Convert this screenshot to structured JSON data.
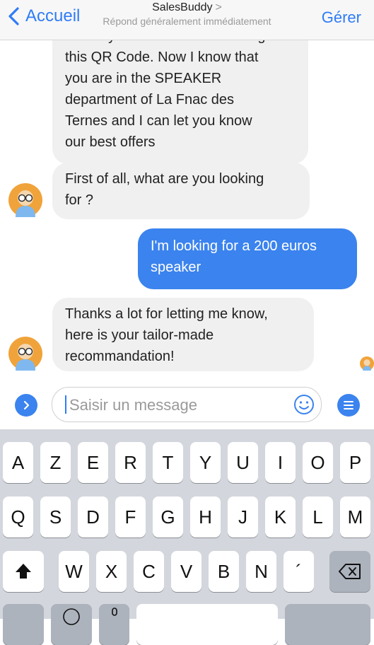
{
  "nav": {
    "back_label": "Accueil",
    "title": "SalesBuddy",
    "subtitle": "Répond généralement immédiatement",
    "right_label": "Gérer"
  },
  "messages": [
    {
      "from": "bot",
      "lines": [
        "Thank you Maxime for scanning",
        "this QR Code. Now I know that",
        "you are in the SPEAKER",
        "department of La Fnac des",
        "Ternes and I can let you know",
        "our best offers"
      ]
    },
    {
      "from": "bot",
      "lines": [
        "First of all, what are you looking",
        "for ?"
      ]
    },
    {
      "from": "user",
      "lines": [
        "I'm looking for a 200 euros",
        "speaker"
      ]
    },
    {
      "from": "bot",
      "lines": [
        "Thanks a lot for letting me know,",
        "here is your tailor-made",
        "recommandation!"
      ]
    }
  ],
  "composer": {
    "placeholder": "Saisir un message"
  },
  "keyboard": {
    "row1": [
      "A",
      "Z",
      "E",
      "R",
      "T",
      "Y",
      "U",
      "I",
      "O",
      "P"
    ],
    "row2": [
      "Q",
      "S",
      "D",
      "F",
      "G",
      "H",
      "J",
      "K",
      "L",
      "M"
    ],
    "row3": [
      "W",
      "X",
      "C",
      "V",
      "B",
      "N",
      "´"
    ]
  },
  "colors": {
    "accent": "#2f7cf6",
    "user_bubble": "#3b83ee",
    "bot_bubble": "#f1f0f0",
    "keyboard_bg": "#d3d6dc"
  }
}
